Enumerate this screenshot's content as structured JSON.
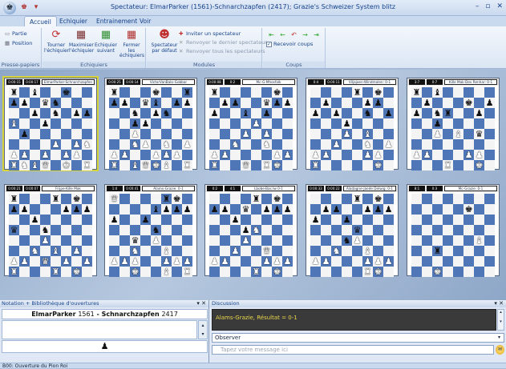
{
  "window": {
    "title": "Spectateur: ElmarParker (1561)-Schnarchzapfen (2417); Grazie's Schweizer System blitz"
  },
  "ribbon_tabs": [
    "Accueil",
    "Echiquier",
    "Entrainement",
    "Voir"
  ],
  "ribbon": {
    "clipboard": {
      "partie": "Partie",
      "position": "Position",
      "label": "Presse-papiers"
    },
    "boards": {
      "tourner": "Tourner l'échiquier",
      "maximiser": "Maximiser l'échiquier",
      "suivant": "Echiquier suivant",
      "fermer": "Fermer les échiquiers",
      "label": "Echiquiers"
    },
    "modules": {
      "spectateur": "Spectateur par défaut",
      "inviter": "Inviter un spectateur",
      "renvoyer_dernier": "Renvoyer le dernier spectateur",
      "renvoyer_tous": "Renvoyer tous les spectateurs",
      "label": "Modules"
    },
    "coups": {
      "recevoir": "Recevoir coups",
      "label": "Coups"
    }
  },
  "boards": [
    {
      "clock1": "0:00:15",
      "clock2": "0:00:17",
      "title": "ElmarParker-Schnarchzapfen",
      "selected": true,
      "rows": [
        "r.b..k..",
        "pp.qn...",
        "..p.n.pp",
        "B..p....",
        ".p......",
        "....P.PN",
        "PP.P.PP.",
        "RNBQ.K.R"
      ]
    },
    {
      "clock1": "0:00:25",
      "clock2": "0:00:14",
      "title": "VictorVanBalo-Gobbar",
      "selected": false,
      "rows": [
        "r...k..r",
        "pp.qb.pp",
        "..n.pn..",
        "..pp....",
        "..P.....",
        "..NP.N.P",
        "PP..PPP.",
        "R.BQKB.R"
      ]
    },
    {
      "clock1": "0:00:08",
      "clock2": "0:2",
      "title": "Mc-G-Mhosfalk",
      "selected": false,
      "rows": [
        "r.....k.",
        ".pp..qpp",
        "p..b.p..",
        "....P...",
        "...P.P..",
        "..N..N..",
        "PP....PP",
        "R..Q.RK."
      ]
    },
    {
      "clock1": "0:4",
      "clock2": "0:00:11",
      "title": "Viljajoen-Windmolen: 0-1",
      "selected": false,
      "rows": [
        "....r.k.",
        ".p...pp.",
        "p.p..n.p",
        "...p....",
        "...P.B..",
        "..P..N.P",
        "PP...PP.",
        "R.....K."
      ]
    },
    {
      "clock1": "3:7",
      "clock2": "0:7",
      "title": "Kille Mak-Dev Renhar: 0-1",
      "selected": false,
      "rows": [
        "r.b.....",
        ".p...k.p",
        "p.nr..p.",
        "..p.....",
        "..P.B.q.",
        "........",
        "PP...PP.",
        "...R..K."
      ]
    },
    {
      "clock1": "0:00:21",
      "clock2": "0:00:07",
      "title": "Frijpe-Kille Mak",
      "selected": false,
      "rows": [
        "r...r.k.",
        "pp...ppp",
        "..p.....",
        "q..n....",
        "...P....",
        "..N.B.P.",
        "PP.Q.P.P",
        "R...R.K."
      ]
    },
    {
      "clock1": "1:4",
      "clock2": "0:00:41",
      "title": "Alams-Grazie: 0-1",
      "selected": false,
      "rows": [
        "Q....rk.",
        "....bppp",
        "p..p....",
        "....n...",
        "..q.P...",
        "..N..B..",
        "PPP..PPP",
        "..K..B.R"
      ]
    },
    {
      "clock1": "0:2",
      "clock2": "4:1",
      "title": "Lbobe-Bas Iw 0-1",
      "selected": false,
      "rows": [
        "....r.k.",
        "pp.q.ppp",
        "..p.....",
        "...pN...",
        "...P....",
        "..P..Q..",
        "PP...PPP",
        "....R.K."
      ]
    },
    {
      "clock1": "0:00:33",
      "clock2": "0:00:22",
      "title": "Aladagne-Jaede Delwig: 0-1",
      "selected": false,
      "rows": [
        "....r.k.",
        ".pp..ppp",
        "p..p....",
        "....q...",
        "...nP...",
        "..N..B..",
        "PP...PPP",
        ".....RK."
      ]
    },
    {
      "clock1": "8:1",
      "clock2": "0:3",
      "title": "Mc-Grazie: 0-1",
      "selected": false,
      "rows": [
        "........",
        ".....k..",
        "........",
        "........",
        "......B.",
        "..r.....",
        "........",
        "..K....."
      ]
    }
  ],
  "notation": {
    "header": "Notation + Bibliothèque d'ouvertures",
    "white": "ElmarParker",
    "white_elo": "1561",
    "black": "Schnarchzapfen",
    "black_elo": "2417",
    "pawn": "♟"
  },
  "discussion": {
    "header": "Discussion",
    "message": "Alams-Grazie, Résultat = 0-1",
    "select_value": "Observer",
    "input_placeholder": "Tapez votre message ici"
  },
  "status": {
    "text": "B00: Ouverture du Pion Roi"
  }
}
